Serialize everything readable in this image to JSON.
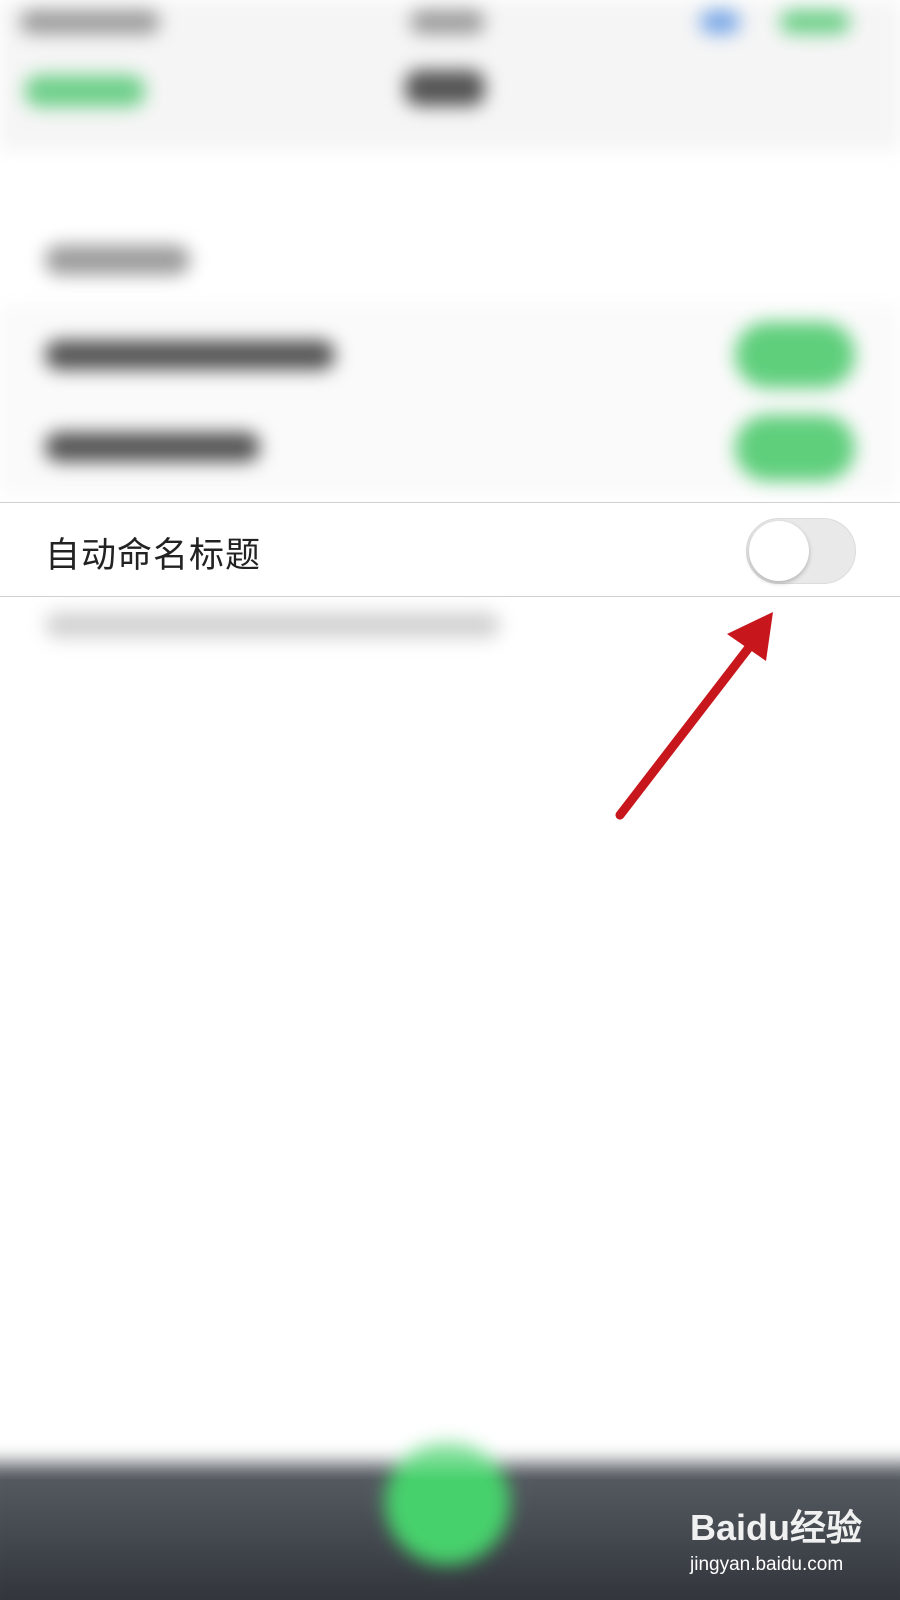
{
  "setting": {
    "label": "自动命名标题",
    "toggle_on": false
  },
  "watermark": {
    "brand": "Baidu经验",
    "url": "jingyan.baidu.com"
  },
  "annotation": {
    "arrow_color": "#c8161d",
    "arrow_icon": "red-arrow-icon"
  },
  "colors": {
    "toggle_off_track": "#e9e9ea",
    "toggle_on_track": "#5fcf7c",
    "fab_green": "#47d16c",
    "tabbar_dark": "#2c3036"
  }
}
